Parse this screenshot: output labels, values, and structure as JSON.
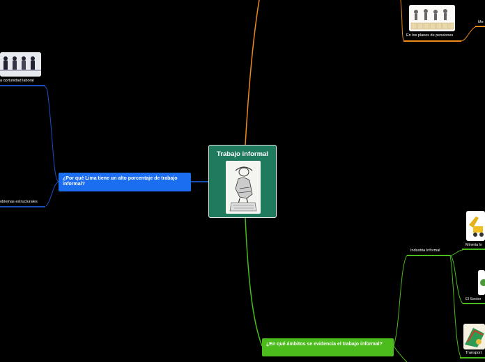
{
  "central": {
    "title": "Trabajo informal",
    "image_icon": "sketch-worker-icon"
  },
  "topics": {
    "lima": "¿Por qué  Lima tiene un alto porcentaje de trabajo informal?",
    "ambitos": "¿En qué ámbitos se evidencia el trabajo informal?"
  },
  "subtopics": {
    "oportunidad": "a oprtunidad laboral",
    "problemas": "oblemas estructurales",
    "pensiones": "En los planes de pensiones",
    "me": "Me",
    "industria": "Industria Informal",
    "mineria": "Mineria In",
    "sector": "El Sector",
    "transporte": "Transport"
  },
  "colors": {
    "background": "#000000",
    "central_fill": "#1f7a5e",
    "blue_branch": "#1b6ef0",
    "green_branch": "#4bbc1c",
    "orange_branch": "#f08a18"
  }
}
